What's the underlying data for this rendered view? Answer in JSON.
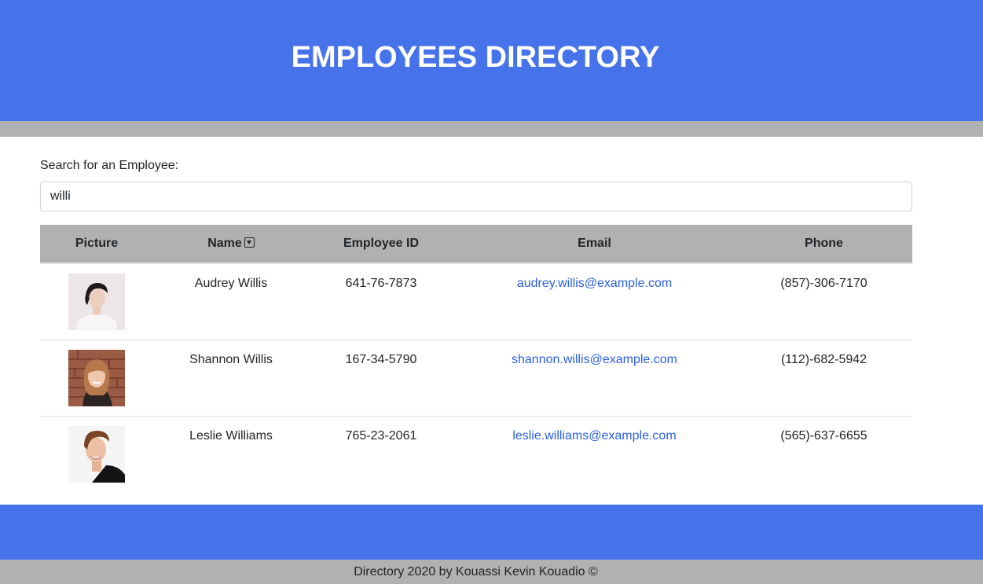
{
  "header": {
    "title": "EMPLOYEES DIRECTORY"
  },
  "search": {
    "label": "Search for an Employee:",
    "value": "willi"
  },
  "table": {
    "headers": {
      "picture": "Picture",
      "name": "Name",
      "employee_id": "Employee ID",
      "email": "Email",
      "phone": "Phone"
    },
    "rows": [
      {
        "name": "Audrey Willis",
        "employee_id": "641-76-7873",
        "email": "audrey.willis@example.com",
        "phone": "(857)-306-7170"
      },
      {
        "name": "Shannon Willis",
        "employee_id": "167-34-5790",
        "email": "shannon.willis@example.com",
        "phone": "(112)-682-5942"
      },
      {
        "name": "Leslie Williams",
        "employee_id": "765-23-2061",
        "email": "leslie.williams@example.com",
        "phone": "(565)-637-6655"
      }
    ]
  },
  "footer": {
    "text": "Directory 2020 by Kouassi Kevin Kouadio ©"
  },
  "colors": {
    "brand_blue": "#4673ea",
    "bar_gray": "#b1b1b1",
    "link": "#2a5fe0"
  },
  "icons": {
    "sort": "sort-down-square-icon"
  }
}
